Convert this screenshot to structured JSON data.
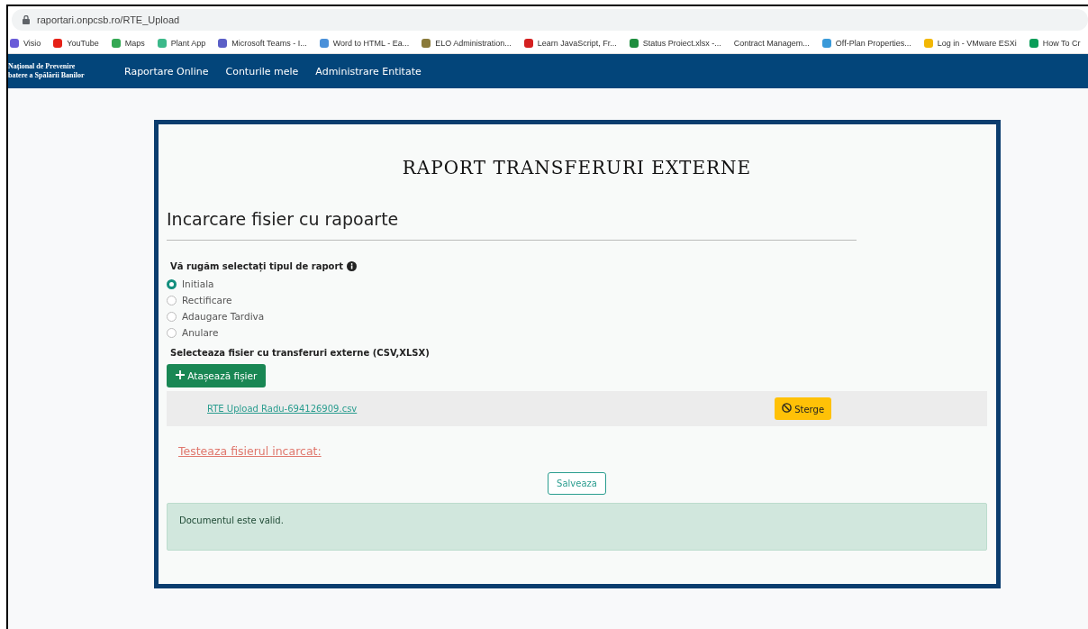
{
  "browser": {
    "url": "raportari.onpcsb.ro/RTE_Upload",
    "bookmarks": [
      {
        "label": "Visio",
        "color": "#6a5cd8"
      },
      {
        "label": "YouTube",
        "color": "#e62117"
      },
      {
        "label": "Maps",
        "color": "#34a853"
      },
      {
        "label": "Plant App",
        "color": "#3cb98a"
      },
      {
        "label": "Microsoft Teams - I...",
        "color": "#5b5fc7"
      },
      {
        "label": "Word to HTML - Ea...",
        "color": "#4a90d9"
      },
      {
        "label": "ELO Administration...",
        "color": "#8a7a3a"
      },
      {
        "label": "Learn JavaScript, Fr...",
        "color": "#d42020"
      },
      {
        "label": "Status Proiect.xlsx -...",
        "color": "#1e8e3e"
      },
      {
        "label": "Contract Managem..."
      },
      {
        "label": "Off-Plan Properties...",
        "color": "#3a9ad9"
      },
      {
        "label": "Log in - VMware ESXi",
        "color": "#f2b705"
      },
      {
        "label": "How To Cr",
        "color": "#0a9d58"
      }
    ]
  },
  "navbar": {
    "brand_lines": [
      "Național de Prevenire",
      "batere a Spălării Banilor"
    ],
    "items": [
      "Raportare Online",
      "Conturile mele",
      "Administrare Entitate"
    ]
  },
  "card": {
    "title": "RAPORT TRANSFERURI EXTERNE",
    "heading": "Incarcare fisier cu rapoarte",
    "report_type": {
      "label": "Vă rugăm selectați tipul de raport",
      "options": [
        {
          "label": "Initiala",
          "selected": true
        },
        {
          "label": "Rectificare",
          "selected": false
        },
        {
          "label": "Adaugare Tardiva",
          "selected": false
        },
        {
          "label": "Anulare",
          "selected": false
        }
      ]
    },
    "file_label": "Selecteaza fisier cu transferuri externe (CSV,XLSX)",
    "attach_button": "Atașează fișier",
    "files": [
      {
        "name": "RTE Upload Radu-694126909.csv",
        "delete_button": "Sterge"
      }
    ],
    "test_link": "Testeaza fisierul incarcat:",
    "save_button": "Salveaza",
    "alert": "Documentul este valid."
  }
}
